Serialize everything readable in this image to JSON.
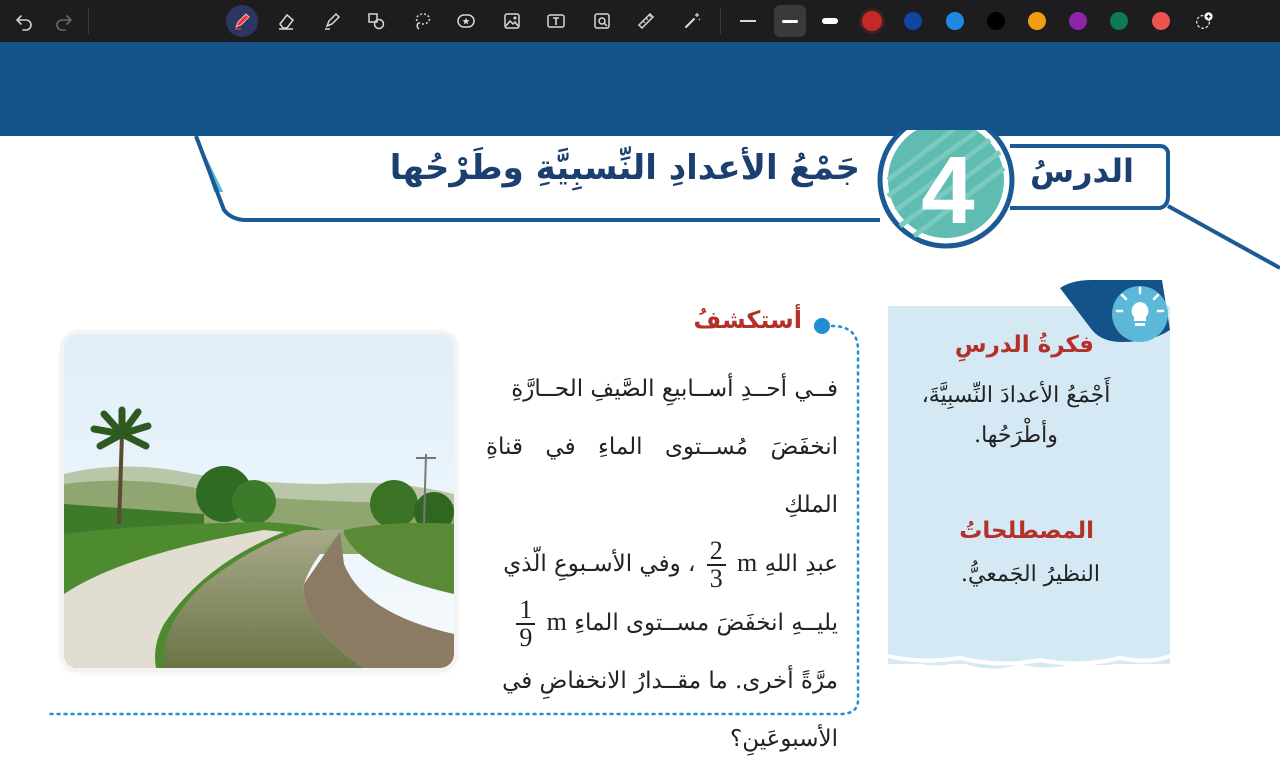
{
  "toolbar": {
    "undo_icon": "undo-icon",
    "redo_icon": "redo-icon",
    "tools": [
      "pen-icon",
      "eraser-icon",
      "highlighter-icon",
      "shapes-icon",
      "lasso-icon",
      "sticker-icon",
      "image-icon",
      "text-icon",
      "image-search-icon",
      "ruler-icon",
      "magic-wand-icon"
    ],
    "stroke_widths": [
      "thin",
      "medium",
      "thick"
    ],
    "colors": [
      "#c62828",
      "#0d47a1",
      "#1e88e5",
      "#000000",
      "#f39c12",
      "#8e24aa",
      "#0b7a55",
      "#ef5350"
    ],
    "selected_color": "#c62828",
    "add_color_icon": "add-color-icon"
  },
  "lesson": {
    "word": "الدرسُ",
    "number": "4",
    "title": "جَمْعُ الأعدادِ النِّسبِيَّةِ وطَرْحُها"
  },
  "explore": {
    "heading": "أستكشفُ",
    "line1": "فــي أحــدِ أســابيعِ الصَّيفِ الحــارَّةِ",
    "line2": "انخفَضَ مُســتوى الماءِ في قناةِ الملكِ",
    "line3_a": "عبدِ اللهِ",
    "frac1_num": "2",
    "frac1_den": "3",
    "unit": "m",
    "line3_b": "، وفي الأسـبوعِ الّذي",
    "line4_a": "يليــهِ انخفَضَ مســتوى الماءِ",
    "frac2_num": "1",
    "frac2_den": "9",
    "line5": "مرَّةً أخرى. ما مقــدارُ الانخفاضِ في",
    "line6": "الأسبوعَينِ؟"
  },
  "photo": {
    "icon": "canal-landscape-photo"
  },
  "card": {
    "icon": "lightbulb-icon",
    "idea_heading": "فكرةُ الدرسِ",
    "idea_text": "أَجْمَعُ الأعدادَ النِّسبِيَّةَ، وأطْرَحُها.",
    "terms_heading": "المصطلحاتُ",
    "terms_text": "النظيرُ الجَمعيُّ."
  }
}
